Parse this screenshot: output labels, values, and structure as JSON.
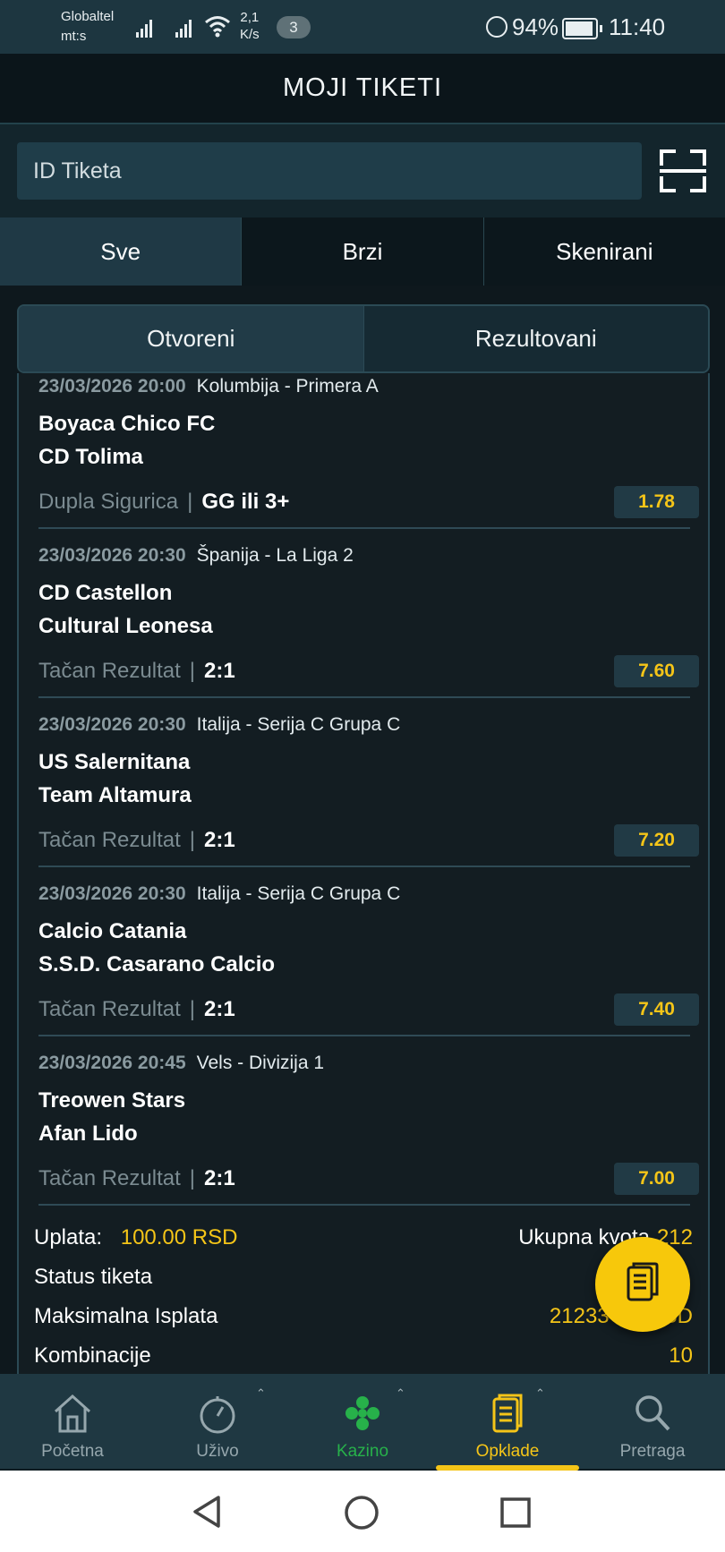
{
  "status_bar": {
    "carrier_line1": "Globaltel",
    "carrier_line2": "mt:s",
    "net_speed_value": "2,1",
    "net_speed_unit": "K/s",
    "notification_count": "3",
    "battery_percent": "94%",
    "time": "11:40"
  },
  "app_bar": {
    "title": "MOJI TIKETI"
  },
  "search": {
    "placeholder": "ID Tiketa",
    "value": ""
  },
  "tabs": [
    {
      "label": "Sve",
      "active": true
    },
    {
      "label": "Brzi",
      "active": false
    },
    {
      "label": "Skenirani",
      "active": false
    }
  ],
  "segments": [
    {
      "label": "Otvoreni",
      "active": true
    },
    {
      "label": "Rezultovani",
      "active": false
    }
  ],
  "matches": [
    {
      "datetime": "23/03/2026 20:00",
      "league": "Kolumbija - Primera A",
      "home": "Boyaca Chico FC",
      "away": "CD Tolima",
      "market": "Dupla Sigurica",
      "pick": "GG ili 3+",
      "odd": "1.78"
    },
    {
      "datetime": "23/03/2026 20:30",
      "league": "Španija - La Liga 2",
      "home": "CD Castellon",
      "away": "Cultural Leonesa",
      "market": "Tačan Rezultat",
      "pick": "2:1",
      "odd": "7.60"
    },
    {
      "datetime": "23/03/2026 20:30",
      "league": "Italija - Serija C Grupa C",
      "home": "US Salernitana",
      "away": "Team Altamura",
      "market": "Tačan Rezultat",
      "pick": "2:1",
      "odd": "7.20"
    },
    {
      "datetime": "23/03/2026 20:30",
      "league": "Italija - Serija C Grupa C",
      "home": "Calcio Catania",
      "away": "S.S.D. Casarano Calcio",
      "market": "Tačan Rezultat",
      "pick": "2:1",
      "odd": "7.40"
    },
    {
      "datetime": "23/03/2026 20:45",
      "league": "Vels - Divizija 1",
      "home": "Treowen Stars",
      "away": "Afan Lido",
      "market": "Tačan Rezultat",
      "pick": "2:1",
      "odd": "7.00"
    }
  ],
  "summary": {
    "uplata_label": "Uplata:",
    "uplata_value": "100.00 RSD",
    "ukupna_kvota_label": "Ukupna kvota",
    "ukupna_kvota_value": "212",
    "status_label": "Status tiketa",
    "max_isplata_label": "Maksimalna Isplata",
    "max_isplata_value": "21233",
    "max_isplata_suffix": "SD",
    "kombinacije_label": "Kombinacije",
    "kombinacije_value": "10"
  },
  "bottom_nav": [
    {
      "label": "Početna",
      "icon": "home-icon"
    },
    {
      "label": "Uživo",
      "icon": "stopwatch-icon"
    },
    {
      "label": "Kazino",
      "icon": "clover-icon"
    },
    {
      "label": "Opklade",
      "icon": "betslip-icon",
      "active": true
    },
    {
      "label": "Pretraga",
      "icon": "search-icon"
    }
  ],
  "colors": {
    "accent_yellow": "#f5c518",
    "kazino_green": "#27b14a",
    "background": "#0f1c22"
  }
}
